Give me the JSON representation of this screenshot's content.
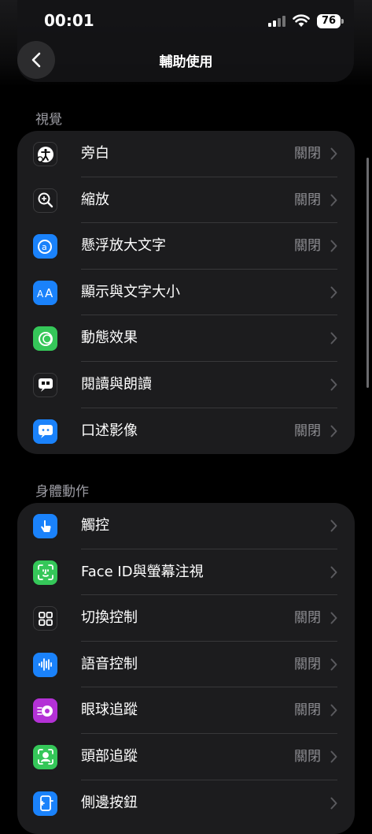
{
  "status_bar": {
    "time": "00:01",
    "battery": "76"
  },
  "nav": {
    "title": "輔助使用"
  },
  "sections": [
    {
      "header": "視覺",
      "rows": [
        {
          "label": "旁白",
          "value": "關閉",
          "icon": "voiceover-icon",
          "color": "#1c1c1e"
        },
        {
          "label": "縮放",
          "value": "關閉",
          "icon": "zoom-icon",
          "color": "#1c1c1e"
        },
        {
          "label": "懸浮放大文字",
          "value": "關閉",
          "icon": "hover-text-icon",
          "color": "#1a82fb"
        },
        {
          "label": "顯示與文字大小",
          "value": "",
          "icon": "text-size-icon",
          "color": "#1a82fb"
        },
        {
          "label": "動態效果",
          "value": "",
          "icon": "motion-icon",
          "color": "#35c759"
        },
        {
          "label": "閱讀與朗讀",
          "value": "",
          "icon": "spoken-content-icon",
          "color": "#1c1c1e"
        },
        {
          "label": "口述影像",
          "value": "關閉",
          "icon": "audio-description-icon",
          "color": "#1a82fb"
        }
      ]
    },
    {
      "header": "身體動作",
      "rows": [
        {
          "label": "觸控",
          "value": "",
          "icon": "touch-icon",
          "color": "#1a82fb"
        },
        {
          "label": "Face ID與螢幕注視",
          "value": "",
          "icon": "face-id-icon",
          "color": "#35c759"
        },
        {
          "label": "切換控制",
          "value": "關閉",
          "icon": "switch-control-icon",
          "color": "#1c1c1e"
        },
        {
          "label": "語音控制",
          "value": "關閉",
          "icon": "voice-control-icon",
          "color": "#1a82fb"
        },
        {
          "label": "眼球追蹤",
          "value": "關閉",
          "icon": "eye-tracking-icon",
          "color": "#b431d6"
        },
        {
          "label": "頭部追蹤",
          "value": "關閉",
          "icon": "head-tracking-icon",
          "color": "#35c759"
        },
        {
          "label": "側邊按鈕",
          "value": "",
          "icon": "side-button-icon",
          "color": "#1a82fb"
        }
      ]
    }
  ]
}
